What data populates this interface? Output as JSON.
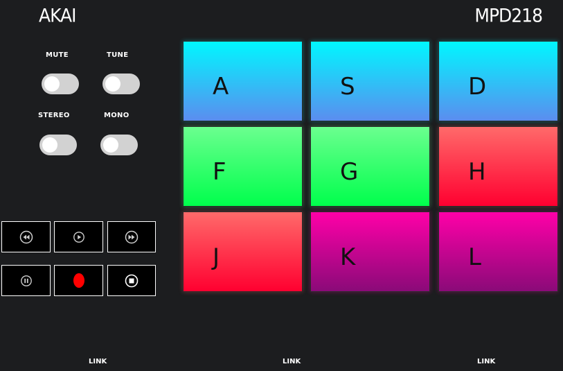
{
  "header": {
    "brand_left": "AKAI",
    "brand_right": "MPD218"
  },
  "toggles": [
    {
      "label": "MUTE",
      "on": false
    },
    {
      "label": "TUNE",
      "on": false
    },
    {
      "label": "STEREO",
      "on": false
    },
    {
      "label": "MONO",
      "on": false
    }
  ],
  "transport": [
    {
      "icon": "rewind-icon"
    },
    {
      "icon": "play-icon"
    },
    {
      "icon": "fast-forward-icon"
    },
    {
      "icon": "pause-icon"
    },
    {
      "icon": "record-icon"
    },
    {
      "icon": "stop-icon"
    }
  ],
  "pads": [
    {
      "letter": "A",
      "color_top": "#00f7ff",
      "color_bottom": "#5b8def"
    },
    {
      "letter": "S",
      "color_top": "#00f7ff",
      "color_bottom": "#5b8def"
    },
    {
      "letter": "D",
      "color_top": "#00f7ff",
      "color_bottom": "#5b8def"
    },
    {
      "letter": "F",
      "color_top": "#6bff8f",
      "color_bottom": "#00ff4c"
    },
    {
      "letter": "G",
      "color_top": "#6bff8f",
      "color_bottom": "#00ff4c"
    },
    {
      "letter": "H",
      "color_top": "#ff6a6a",
      "color_bottom": "#ff0030"
    },
    {
      "letter": "J",
      "color_top": "#ff6a6a",
      "color_bottom": "#ff0030"
    },
    {
      "letter": "K",
      "color_top": "#ff00a8",
      "color_bottom": "#8a0a78"
    },
    {
      "letter": "L",
      "color_top": "#ff00a8",
      "color_bottom": "#8a0a78"
    }
  ],
  "footer": {
    "links": [
      "LINK",
      "LINK",
      "LINK"
    ]
  }
}
